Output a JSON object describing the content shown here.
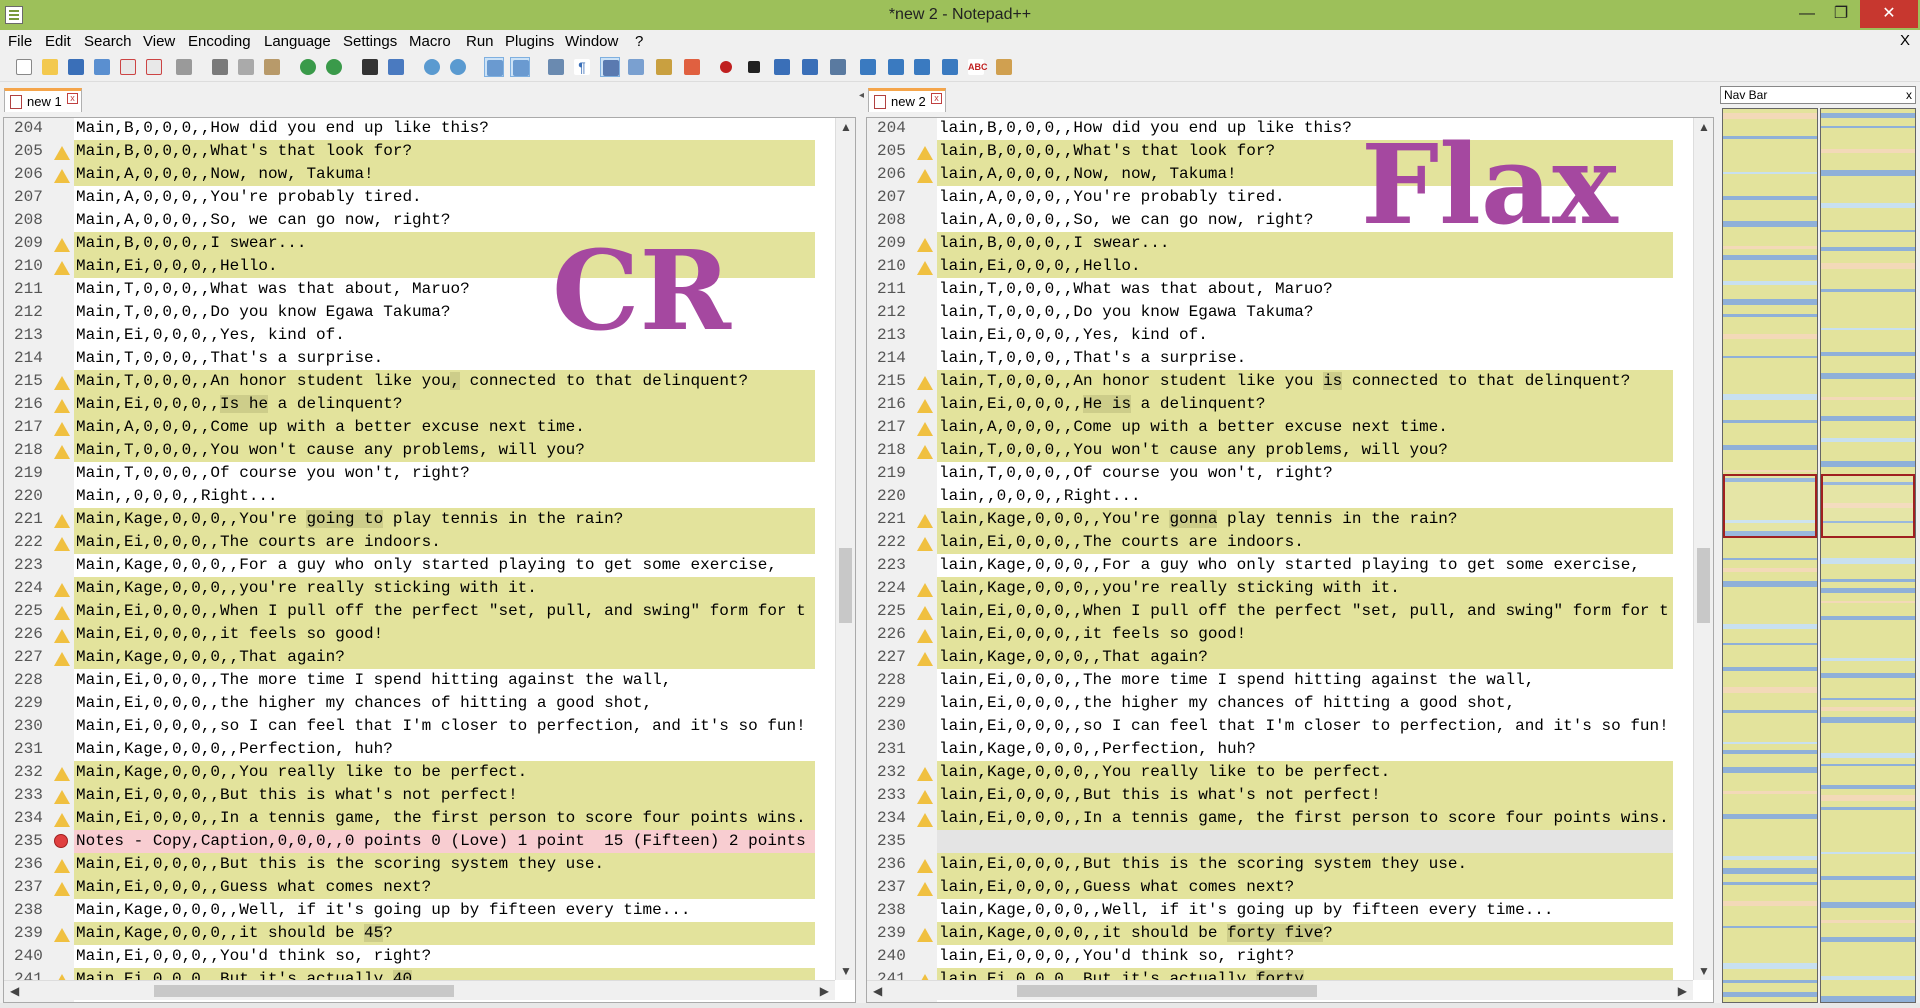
{
  "window": {
    "title": "*new  2 - Notepad++",
    "minimize": "—",
    "maximize": "❐",
    "close": "✕"
  },
  "menu": {
    "items": [
      "File",
      "Edit",
      "Search",
      "View",
      "Encoding",
      "Language",
      "Settings",
      "Macro",
      "Run",
      "Plugins",
      "Window",
      "?"
    ],
    "close_x": "X"
  },
  "toolbar": {
    "icons": [
      "new-file",
      "open-file",
      "save",
      "save-all",
      "close",
      "close-all",
      "print",
      "cut",
      "copy",
      "paste",
      "undo",
      "redo",
      "find",
      "replace",
      "zoom-in",
      "zoom-out",
      "sync-vertical",
      "sync-horizontal",
      "word-wrap",
      "show-all-chars",
      "indent-guide",
      "doc-map",
      "function-list",
      "folder-as-workspace",
      "record-macro",
      "stop-record",
      "play-macro",
      "run-macro-multiple",
      "save-macro",
      "compare-first",
      "compare-prev",
      "compare-next",
      "compare-last",
      "compare-clear",
      "spell-check",
      "doc-switcher"
    ]
  },
  "left_tab": {
    "label": "new  1",
    "close": "x"
  },
  "right_tab": {
    "label": "new  2",
    "close": "x"
  },
  "left_overlay": "CR",
  "right_overlay": "Flax",
  "navbar": {
    "title": "Nav Bar",
    "close": "x"
  },
  "colors": {
    "titlebar": "#9dc05a",
    "changed_line": "#e3e39c",
    "removed_line": "#f8cdd1",
    "overlay_text": "#a548a0",
    "nav_blue": "#8fb0d8"
  },
  "left_lines": [
    {
      "num": "204",
      "mark": "",
      "state": "plain",
      "pre": "Main,B,0,0,0,,How did you end up like this?",
      "hl": "",
      "post": ""
    },
    {
      "num": "205",
      "mark": "warn",
      "state": "changed",
      "pre": "Main,B,0,0,0,,What's that look for?",
      "hl": "",
      "post": ""
    },
    {
      "num": "206",
      "mark": "warn",
      "state": "changed",
      "pre": "Main,A,0,0,0,,Now, now, Takuma!",
      "hl": "",
      "post": ""
    },
    {
      "num": "207",
      "mark": "",
      "state": "plain",
      "pre": "Main,A,0,0,0,,You're probably tired.",
      "hl": "",
      "post": ""
    },
    {
      "num": "208",
      "mark": "",
      "state": "plain",
      "pre": "Main,A,0,0,0,,So, we can go now, right?",
      "hl": "",
      "post": ""
    },
    {
      "num": "209",
      "mark": "warn",
      "state": "changed",
      "pre": "Main,B,0,0,0,,I swear...",
      "hl": "",
      "post": ""
    },
    {
      "num": "210",
      "mark": "warn",
      "state": "changed",
      "pre": "Main,Ei,0,0,0,,Hello.",
      "hl": "",
      "post": ""
    },
    {
      "num": "211",
      "mark": "",
      "state": "plain",
      "pre": "Main,T,0,0,0,,What was that about, Maruo?",
      "hl": "",
      "post": ""
    },
    {
      "num": "212",
      "mark": "",
      "state": "plain",
      "pre": "Main,T,0,0,0,,Do you know Egawa Takuma?",
      "hl": "",
      "post": ""
    },
    {
      "num": "213",
      "mark": "",
      "state": "plain",
      "pre": "Main,Ei,0,0,0,,Yes, kind of.",
      "hl": "",
      "post": ""
    },
    {
      "num": "214",
      "mark": "",
      "state": "plain",
      "pre": "Main,T,0,0,0,,That's a surprise.",
      "hl": "",
      "post": ""
    },
    {
      "num": "215",
      "mark": "warn",
      "state": "changed",
      "pre": "Main,T,0,0,0,,An honor student like you",
      "hl": ",",
      "post": " connected to that delinquent?"
    },
    {
      "num": "216",
      "mark": "warn",
      "state": "changed",
      "pre": "Main,Ei,0,0,0,,",
      "hl": "Is he",
      "post": " a delinquent?"
    },
    {
      "num": "217",
      "mark": "warn",
      "state": "changed",
      "pre": "Main,A,0,0,0,,Come up with a better excuse next time.",
      "hl": "",
      "post": ""
    },
    {
      "num": "218",
      "mark": "warn",
      "state": "changed",
      "pre": "Main,T,0,0,0,,You won't cause any problems, will you?",
      "hl": "",
      "post": ""
    },
    {
      "num": "219",
      "mark": "",
      "state": "plain",
      "pre": "Main,T,0,0,0,,Of course you won't, right?",
      "hl": "",
      "post": ""
    },
    {
      "num": "220",
      "mark": "",
      "state": "plain",
      "pre": "Main,,0,0,0,,Right...",
      "hl": "",
      "post": ""
    },
    {
      "num": "221",
      "mark": "warn",
      "state": "changed",
      "pre": "Main,Kage,0,0,0,,You're ",
      "hl": "going to",
      "post": " play tennis in the rain?"
    },
    {
      "num": "222",
      "mark": "warn",
      "state": "changed",
      "pre": "Main,Ei,0,0,0,,The courts are indoors.",
      "hl": "",
      "post": ""
    },
    {
      "num": "223",
      "mark": "",
      "state": "plain",
      "pre": "Main,Kage,0,0,0,,For a guy who only started playing to get some exercise,",
      "hl": "",
      "post": ""
    },
    {
      "num": "224",
      "mark": "warn",
      "state": "changed",
      "pre": "Main,Kage,0,0,0,,you're really sticking with it.",
      "hl": "",
      "post": ""
    },
    {
      "num": "225",
      "mark": "warn",
      "state": "changed",
      "pre": "Main,Ei,0,0,0,,When I pull off the perfect \"set, pull, and swing\" form for t",
      "hl": "",
      "post": ""
    },
    {
      "num": "226",
      "mark": "warn",
      "state": "changed",
      "pre": "Main,Ei,0,0,0,,it feels so good!",
      "hl": "",
      "post": ""
    },
    {
      "num": "227",
      "mark": "warn",
      "state": "changed",
      "pre": "Main,Kage,0,0,0,,That again?",
      "hl": "",
      "post": ""
    },
    {
      "num": "228",
      "mark": "",
      "state": "plain",
      "pre": "Main,Ei,0,0,0,,The more time I spend hitting against the wall,",
      "hl": "",
      "post": ""
    },
    {
      "num": "229",
      "mark": "",
      "state": "plain",
      "pre": "Main,Ei,0,0,0,,the higher my chances of hitting a good shot,",
      "hl": "",
      "post": ""
    },
    {
      "num": "230",
      "mark": "",
      "state": "plain",
      "pre": "Main,Ei,0,0,0,,so I can feel that I'm closer to perfection, and it's so fun!",
      "hl": "",
      "post": ""
    },
    {
      "num": "231",
      "mark": "",
      "state": "plain",
      "pre": "Main,Kage,0,0,0,,Perfection, huh?",
      "hl": "",
      "post": ""
    },
    {
      "num": "232",
      "mark": "warn",
      "state": "changed",
      "pre": "Main,Kage,0,0,0,,You really like to be perfect.",
      "hl": "",
      "post": ""
    },
    {
      "num": "233",
      "mark": "warn",
      "state": "changed",
      "pre": "Main,Ei,0,0,0,,But this is what's not perfect!",
      "hl": "",
      "post": ""
    },
    {
      "num": "234",
      "mark": "warn",
      "state": "changed",
      "pre": "Main,Ei,0,0,0,,In a tennis game, the first person to score four points wins.",
      "hl": "",
      "post": ""
    },
    {
      "num": "235",
      "mark": "err",
      "state": "removed",
      "pre": "Notes - Copy,Caption,0,0,0,,0 points 0 (Love) 1 point  15 (Fifteen) 2 points",
      "hl": "",
      "post": ""
    },
    {
      "num": "236",
      "mark": "warn",
      "state": "changed",
      "pre": "Main,Ei,0,0,0,,But this is the scoring system they use.",
      "hl": "",
      "post": ""
    },
    {
      "num": "237",
      "mark": "warn",
      "state": "changed",
      "pre": "Main,Ei,0,0,0,,Guess what comes next?",
      "hl": "",
      "post": ""
    },
    {
      "num": "238",
      "mark": "",
      "state": "plain",
      "pre": "Main,Kage,0,0,0,,Well, if it's going up by fifteen every time...",
      "hl": "",
      "post": ""
    },
    {
      "num": "239",
      "mark": "warn",
      "state": "changed",
      "pre": "Main,Kage,0,0,0,,it should be ",
      "hl": "45",
      "post": "?"
    },
    {
      "num": "240",
      "mark": "",
      "state": "plain",
      "pre": "Main,Ei,0,0,0,,You'd think so, right?",
      "hl": "",
      "post": ""
    },
    {
      "num": "241",
      "mark": "warn",
      "state": "changed",
      "pre": "Main,Ei,0,0,0,,But it's actually ",
      "hl": "40",
      "post": "."
    }
  ],
  "right_lines": [
    {
      "num": "204",
      "mark": "",
      "state": "plain",
      "pre": "lain,B,0,0,0,,How did you end up like this?",
      "hl": "",
      "post": ""
    },
    {
      "num": "205",
      "mark": "warn",
      "state": "changed",
      "pre": "lain,B,0,0,0,,What's that look for?",
      "hl": "",
      "post": ""
    },
    {
      "num": "206",
      "mark": "warn",
      "state": "changed",
      "pre": "lain,A,0,0,0,,Now, now, Takuma!",
      "hl": "",
      "post": ""
    },
    {
      "num": "207",
      "mark": "",
      "state": "plain",
      "pre": "lain,A,0,0,0,,You're probably tired.",
      "hl": "",
      "post": ""
    },
    {
      "num": "208",
      "mark": "",
      "state": "plain",
      "pre": "lain,A,0,0,0,,So, we can go now, right?",
      "hl": "",
      "post": ""
    },
    {
      "num": "209",
      "mark": "warn",
      "state": "changed",
      "pre": "lain,B,0,0,0,,I swear...",
      "hl": "",
      "post": ""
    },
    {
      "num": "210",
      "mark": "warn",
      "state": "changed",
      "pre": "lain,Ei,0,0,0,,Hello.",
      "hl": "",
      "post": ""
    },
    {
      "num": "211",
      "mark": "",
      "state": "plain",
      "pre": "lain,T,0,0,0,,What was that about, Maruo?",
      "hl": "",
      "post": ""
    },
    {
      "num": "212",
      "mark": "",
      "state": "plain",
      "pre": "lain,T,0,0,0,,Do you know Egawa Takuma?",
      "hl": "",
      "post": ""
    },
    {
      "num": "213",
      "mark": "",
      "state": "plain",
      "pre": "lain,Ei,0,0,0,,Yes, kind of.",
      "hl": "",
      "post": ""
    },
    {
      "num": "214",
      "mark": "",
      "state": "plain",
      "pre": "lain,T,0,0,0,,That's a surprise.",
      "hl": "",
      "post": ""
    },
    {
      "num": "215",
      "mark": "warn",
      "state": "changed",
      "pre": "lain,T,0,0,0,,An honor student like you ",
      "hl": "is",
      "post": " connected to that delinquent?"
    },
    {
      "num": "216",
      "mark": "warn",
      "state": "changed",
      "pre": "lain,Ei,0,0,0,,",
      "hl": "He is",
      "post": " a delinquent?"
    },
    {
      "num": "217",
      "mark": "warn",
      "state": "changed",
      "pre": "lain,A,0,0,0,,Come up with a better excuse next time.",
      "hl": "",
      "post": ""
    },
    {
      "num": "218",
      "mark": "warn",
      "state": "changed",
      "pre": "lain,T,0,0,0,,You won't cause any problems, will you?",
      "hl": "",
      "post": ""
    },
    {
      "num": "219",
      "mark": "",
      "state": "plain",
      "pre": "lain,T,0,0,0,,Of course you won't, right?",
      "hl": "",
      "post": ""
    },
    {
      "num": "220",
      "mark": "",
      "state": "plain",
      "pre": "lain,,0,0,0,,Right...",
      "hl": "",
      "post": ""
    },
    {
      "num": "221",
      "mark": "warn",
      "state": "changed",
      "pre": "lain,Kage,0,0,0,,You're ",
      "hl": "gonna",
      "post": " play tennis in the rain?"
    },
    {
      "num": "222",
      "mark": "warn",
      "state": "changed",
      "pre": "lain,Ei,0,0,0,,The courts are indoors.",
      "hl": "",
      "post": ""
    },
    {
      "num": "223",
      "mark": "",
      "state": "plain",
      "pre": "lain,Kage,0,0,0,,For a guy who only started playing to get some exercise,",
      "hl": "",
      "post": ""
    },
    {
      "num": "224",
      "mark": "warn",
      "state": "changed",
      "pre": "lain,Kage,0,0,0,,you're really sticking with it.",
      "hl": "",
      "post": ""
    },
    {
      "num": "225",
      "mark": "warn",
      "state": "changed",
      "pre": "lain,Ei,0,0,0,,When I pull off the perfect \"set, pull, and swing\" form for t",
      "hl": "",
      "post": ""
    },
    {
      "num": "226",
      "mark": "warn",
      "state": "changed",
      "pre": "lain,Ei,0,0,0,,it feels so good!",
      "hl": "",
      "post": ""
    },
    {
      "num": "227",
      "mark": "warn",
      "state": "changed",
      "pre": "lain,Kage,0,0,0,,That again?",
      "hl": "",
      "post": ""
    },
    {
      "num": "228",
      "mark": "",
      "state": "plain",
      "pre": "lain,Ei,0,0,0,,The more time I spend hitting against the wall,",
      "hl": "",
      "post": ""
    },
    {
      "num": "229",
      "mark": "",
      "state": "plain",
      "pre": "lain,Ei,0,0,0,,the higher my chances of hitting a good shot,",
      "hl": "",
      "post": ""
    },
    {
      "num": "230",
      "mark": "",
      "state": "plain",
      "pre": "lain,Ei,0,0,0,,so I can feel that I'm closer to perfection, and it's so fun!",
      "hl": "",
      "post": ""
    },
    {
      "num": "231",
      "mark": "",
      "state": "plain",
      "pre": "lain,Kage,0,0,0,,Perfection, huh?",
      "hl": "",
      "post": ""
    },
    {
      "num": "232",
      "mark": "warn",
      "state": "changed",
      "pre": "lain,Kage,0,0,0,,You really like to be perfect.",
      "hl": "",
      "post": ""
    },
    {
      "num": "233",
      "mark": "warn",
      "state": "changed",
      "pre": "lain,Ei,0,0,0,,But this is what's not perfect!",
      "hl": "",
      "post": ""
    },
    {
      "num": "234",
      "mark": "warn",
      "state": "changed",
      "pre": "lain,Ei,0,0,0,,In a tennis game, the first person to score four points wins.",
      "hl": "",
      "post": ""
    },
    {
      "num": "235",
      "mark": "",
      "state": "blank",
      "pre": "",
      "hl": "",
      "post": ""
    },
    {
      "num": "236",
      "mark": "warn",
      "state": "changed",
      "pre": "lain,Ei,0,0,0,,But this is the scoring system they use.",
      "hl": "",
      "post": ""
    },
    {
      "num": "237",
      "mark": "warn",
      "state": "changed",
      "pre": "lain,Ei,0,0,0,,Guess what comes next?",
      "hl": "",
      "post": ""
    },
    {
      "num": "238",
      "mark": "",
      "state": "plain",
      "pre": "lain,Kage,0,0,0,,Well, if it's going up by fifteen every time...",
      "hl": "",
      "post": ""
    },
    {
      "num": "239",
      "mark": "warn",
      "state": "changed",
      "pre": "lain,Kage,0,0,0,,it should be ",
      "hl": "forty five",
      "post": "?"
    },
    {
      "num": "240",
      "mark": "",
      "state": "plain",
      "pre": "lain,Ei,0,0,0,,You'd think so, right?",
      "hl": "",
      "post": ""
    },
    {
      "num": "241",
      "mark": "warn",
      "state": "changed",
      "pre": "lain,Ei,0,0,0,,But it's actually ",
      "hl": "forty",
      "post": "."
    }
  ]
}
